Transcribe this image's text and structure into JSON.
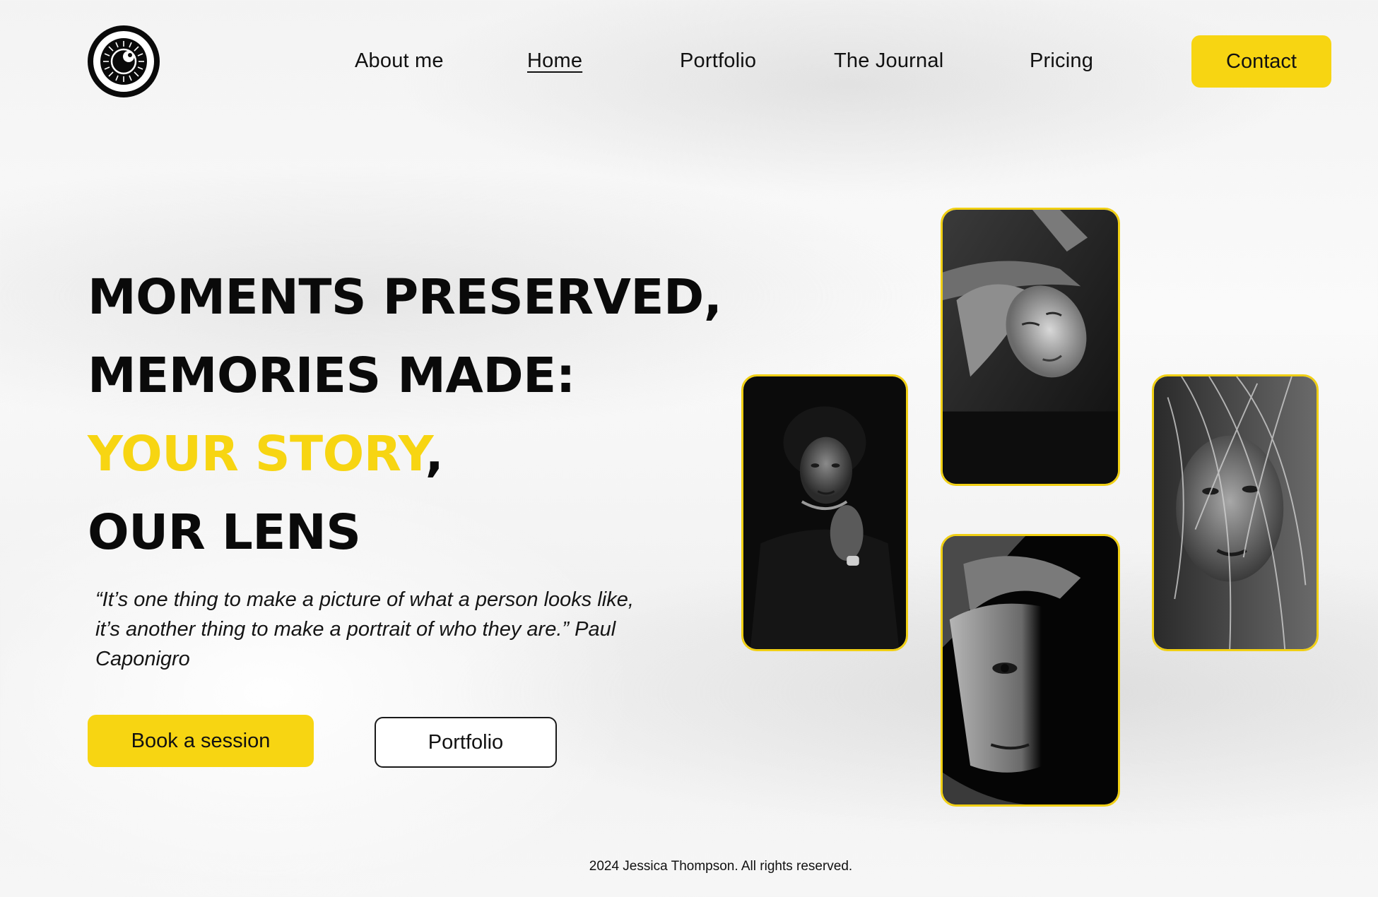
{
  "logo": {
    "icon": "camera-lens-icon"
  },
  "nav": {
    "items": [
      {
        "label": "About me",
        "active": false
      },
      {
        "label": "Home",
        "active": true
      },
      {
        "label": "Portfolio",
        "active": false
      },
      {
        "label": "The Journal",
        "active": false
      },
      {
        "label": "Pricing",
        "active": false
      }
    ],
    "contact_label": "Contact"
  },
  "hero": {
    "line1": "MOMENTS PRESERVED,",
    "line2": "MEMORIES MADE:",
    "line3_accent": "YOUR STORY",
    "line3_rest": ",",
    "line4": "OUR LENS",
    "quote": "“It’s one thing to make a picture of what a person looks like, it’s another thing to make a portrait of who they are.” Paul Caponigro",
    "primary_button": "Book a session",
    "secondary_button": "Portfolio"
  },
  "gallery": {
    "photos": [
      {
        "name": "portrait-photo-1"
      },
      {
        "name": "portrait-photo-2"
      },
      {
        "name": "portrait-photo-3"
      },
      {
        "name": "portrait-photo-4"
      }
    ]
  },
  "footer": {
    "text": "2024 Jessica Thompson. All rights reserved."
  },
  "colors": {
    "accent": "#f7d512",
    "text": "#0b0b0b",
    "photo_border": "#f0cf14"
  }
}
